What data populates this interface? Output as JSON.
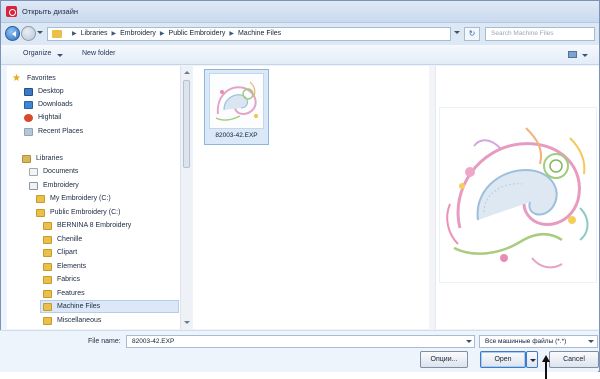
{
  "window": {
    "title": "Открыть дизайн"
  },
  "address": {
    "breadcrumbs": [
      "Libraries",
      "Embroidery",
      "Public Embroidery",
      "Machine Files"
    ],
    "search_placeholder": "Search Machine Files"
  },
  "toolbar": {
    "organize_label": "Organize",
    "new_folder_label": "New folder"
  },
  "sidebar": {
    "items": [
      {
        "label": "Favorites",
        "icon": "star-icon"
      },
      {
        "label": "Desktop",
        "icon": "desktop-icon"
      },
      {
        "label": "Downloads",
        "icon": "downloads-icon"
      },
      {
        "label": "Hightail",
        "icon": "hightail-icon"
      },
      {
        "label": "Recent Places",
        "icon": "recent-places-icon"
      },
      {
        "label": "Libraries",
        "icon": "libraries-icon"
      },
      {
        "label": "Documents",
        "icon": "documents-icon"
      },
      {
        "label": "Embroidery",
        "icon": "embroidery-icon"
      },
      {
        "label": "My Embroidery (C:)",
        "icon": "folder-icon"
      },
      {
        "label": "Public Embroidery (C:)",
        "icon": "folder-icon"
      },
      {
        "label": "BERNINA 8 Embroidery",
        "icon": "folder-icon"
      },
      {
        "label": "Chenille",
        "icon": "folder-icon"
      },
      {
        "label": "Clipart",
        "icon": "folder-icon"
      },
      {
        "label": "Elements",
        "icon": "folder-icon"
      },
      {
        "label": "Fabrics",
        "icon": "folder-icon"
      },
      {
        "label": "Features",
        "icon": "folder-icon"
      },
      {
        "label": "Machine Files",
        "icon": "folder-icon"
      },
      {
        "label": "Miscellaneous",
        "icon": "folder-icon"
      }
    ]
  },
  "files": [
    {
      "name": "82003-42.EXP"
    }
  ],
  "footer": {
    "file_name_label": "File name:",
    "file_name_value": "82003-42.EXP",
    "filter_value": "Все машинные файлы (*.*)",
    "options_label": "Опции...",
    "open_label": "Open",
    "cancel_label": "Cancel"
  },
  "colors": {
    "accent": "#3d7bc9",
    "selection": "#dce8f7",
    "folder": "#e9c04c"
  }
}
